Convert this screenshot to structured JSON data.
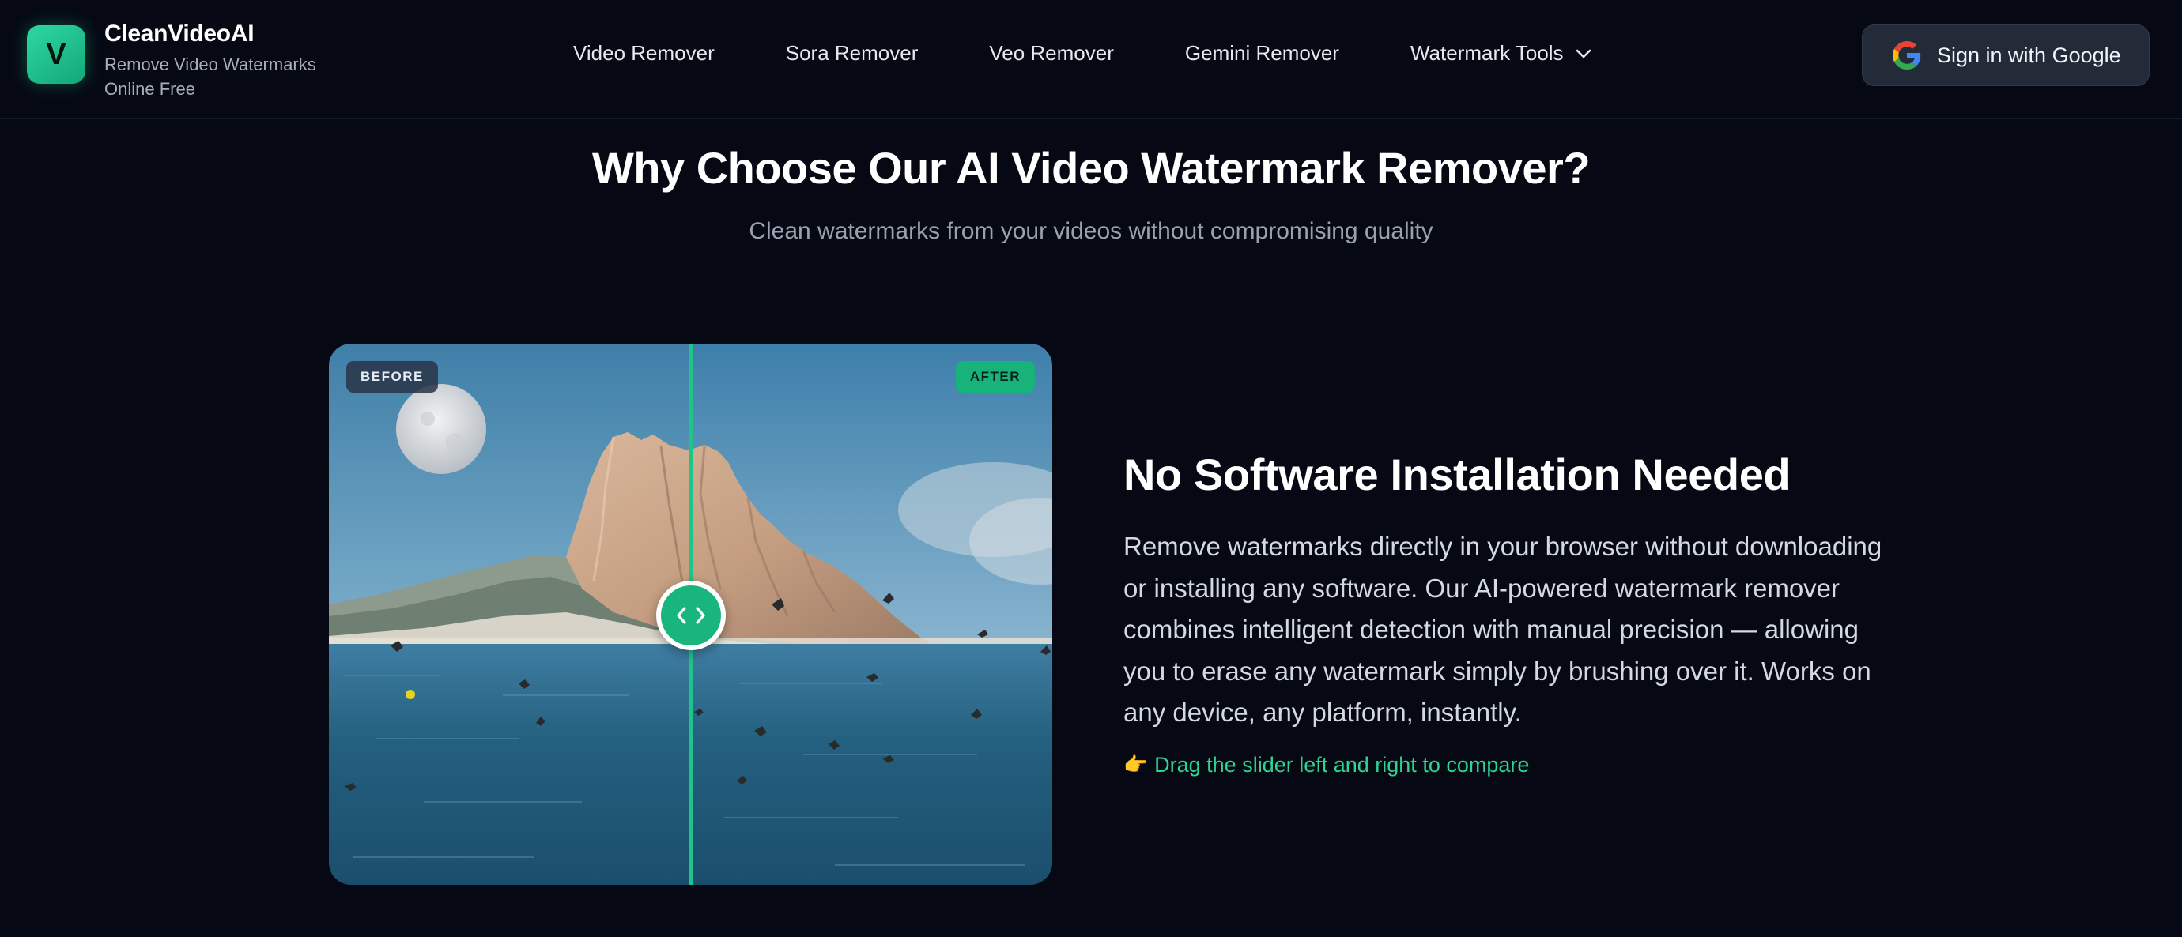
{
  "header": {
    "logo_letter": "V",
    "brand_name": "CleanVideoAI",
    "brand_tagline": "Remove Video Watermarks Online Free",
    "nav": [
      {
        "label": "Video Remover"
      },
      {
        "label": "Sora Remover"
      },
      {
        "label": "Veo Remover"
      },
      {
        "label": "Gemini Remover"
      },
      {
        "label": "Watermark Tools",
        "has_dropdown": true
      }
    ],
    "signin_label": "Sign in with Google",
    "signin_icon": "google-g-icon"
  },
  "section": {
    "title": "Why Choose Our AI Video Watermark Remover?",
    "subtitle": "Clean watermarks from your videos without compromising quality"
  },
  "compare": {
    "before_label": "BEFORE",
    "after_label": "AFTER",
    "slider_position": 0.5,
    "handle_icon": "chevrons-left-right-icon"
  },
  "feature": {
    "title": "No Software Installation Needed",
    "body": "Remove watermarks directly in your browser without downloading or installing any software. Our AI-powered watermark remover combines intelligent detection with manual precision — allowing you to erase any watermark simply by brushing over it. Works on any device, any platform, instantly.",
    "hint_icon": "👉",
    "hint": "Drag the slider left and right to compare"
  },
  "colors": {
    "background": "#060914",
    "accent": "#17b37b",
    "hint": "#2fd493"
  }
}
